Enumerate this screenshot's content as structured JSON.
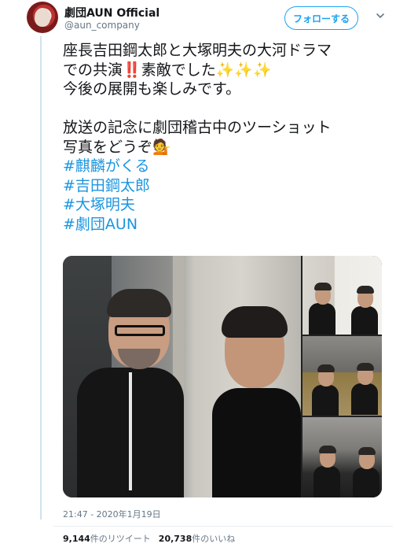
{
  "user": {
    "name": "劇団AUN Official",
    "handle": "@aun_company",
    "follow_label": "フォローする"
  },
  "tweet": {
    "line1": "座長吉田鋼太郎と大塚明夫の大河ドラマ",
    "line2_prefix": "での共演",
    "line2_bang": "‼️",
    "line2_mid": "素敵でした",
    "line2_sparkles": "✨✨✨",
    "line3": "今後の展開も楽しみです。",
    "line4": "放送の記念に劇団稽古中のツーショット",
    "line5_prefix": "写真をどうぞ",
    "line5_emoji": "💁",
    "hashtags": [
      "#麒麟がくる",
      "#吉田鋼太郎",
      "#大塚明夫",
      "#劇団AUN"
    ]
  },
  "meta": {
    "timestamp": "21:47 - 2020年1月19日",
    "retweet_count": "9,144",
    "retweet_label": "件のリツイート",
    "like_count": "20,738",
    "like_label": "件のいいね"
  },
  "colors": {
    "accent": "#1da1f2",
    "hashtag": "#1b95e0",
    "secondary_text": "#657786"
  },
  "icons": {
    "more": "chevron-down-icon",
    "avatar": "avatar"
  }
}
